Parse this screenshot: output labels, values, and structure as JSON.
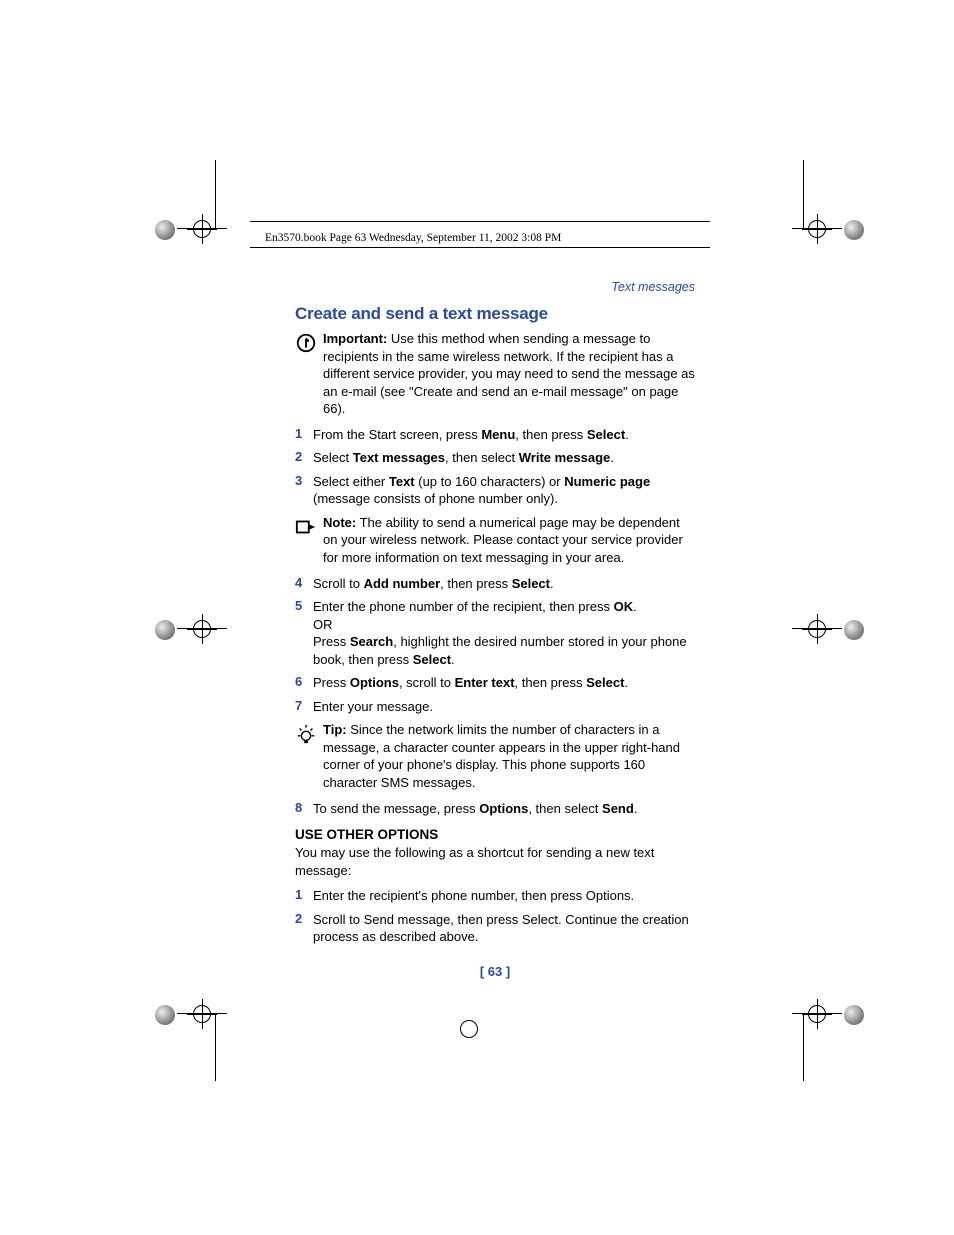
{
  "file_header": "En3570.book  Page 63  Wednesday, September 11, 2002  3:08 PM",
  "section_label": "Text messages",
  "heading": "Create and send a text message",
  "important": {
    "label": "Important:",
    "text": " Use this method when sending a message to recipients in the same wireless network. If the recipient has a different service provider, you may need to send the message as an e-mail (see \"Create and send an e-mail message\" on page 66)."
  },
  "steps_a": [
    {
      "n": "1",
      "pre": "From the Start screen, press ",
      "b1": "Menu",
      "mid": ", then press ",
      "b2": "Select",
      "post": "."
    },
    {
      "n": "2",
      "pre": "Select ",
      "b1": "Text messages",
      "mid": ", then select ",
      "b2": "Write message",
      "post": "."
    },
    {
      "n": "3",
      "pre": "Select either ",
      "b1": "Text",
      "mid": " (up to 160 characters) or ",
      "b2": "Numeric page",
      "post": " (message consists of phone number only)."
    }
  ],
  "note": {
    "label": "Note:",
    "text": " The ability to send a numerical page may be dependent on your wireless network. Please contact your service provider for more information on text messaging in your area."
  },
  "steps_b": [
    {
      "n": "4",
      "pre": "Scroll to ",
      "b1": "Add number",
      "mid": ", then press ",
      "b2": "Select",
      "post": "."
    },
    {
      "n": "5",
      "pre": "Enter the phone number of the recipient, then press ",
      "b1": "OK",
      "post": ".",
      "line2": "OR",
      "line3_pre": "Press ",
      "line3_b1": "Search",
      "line3_mid": ", highlight the desired number stored in your phone book, then press ",
      "line3_b2": "Select",
      "line3_post": "."
    },
    {
      "n": "6",
      "pre": "Press ",
      "b1": "Options",
      "mid": ", scroll to ",
      "b2": "Enter text",
      "mid2": ", then press ",
      "b3": "Select",
      "post": "."
    },
    {
      "n": "7",
      "pre": "Enter your message."
    }
  ],
  "tip": {
    "label": "Tip:",
    "text": "  Since the network limits the number of characters in a message, a character counter appears in the upper right-hand corner of your phone's display. This phone supports 160 character SMS messages."
  },
  "steps_c": [
    {
      "n": "8",
      "pre": "To send the message, press ",
      "b1": "Options",
      "mid": ", then select ",
      "b2": "Send",
      "post": "."
    }
  ],
  "subhead": "USE OTHER OPTIONS",
  "subhead_text": "You may use the following as a shortcut for sending a new text message:",
  "steps_d": [
    {
      "n": "1",
      "pre": "Enter the recipient's phone number, then press Options."
    },
    {
      "n": "2",
      "pre": "Scroll to Send message, then press Select. Continue the creation process as described above."
    }
  ],
  "page_number": "[ 63 ]"
}
